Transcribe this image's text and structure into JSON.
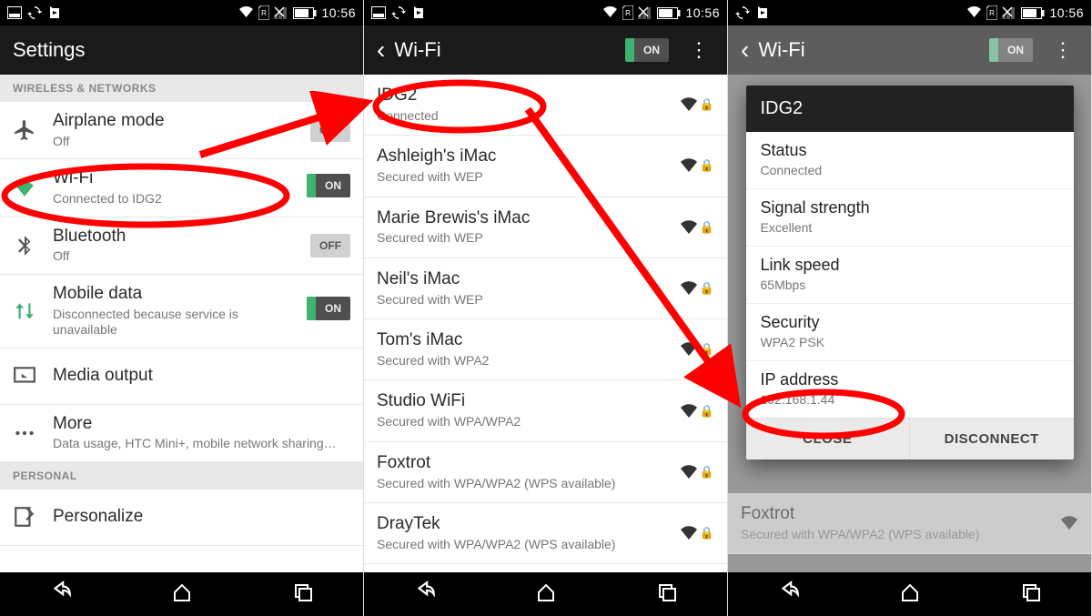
{
  "statusbar": {
    "time": "10:56"
  },
  "screen1": {
    "title": "Settings",
    "section1": "WIRELESS & NETWORKS",
    "section2": "PERSONAL",
    "rows": {
      "airplane": {
        "title": "Airplane mode",
        "sub": "Off",
        "toggle": "OFF"
      },
      "wifi": {
        "title": "Wi-Fi",
        "sub": "Connected to IDG2",
        "toggle": "ON"
      },
      "bluetooth": {
        "title": "Bluetooth",
        "sub": "Off",
        "toggle": "OFF"
      },
      "mobile": {
        "title": "Mobile data",
        "sub": "Disconnected because service is unavailable",
        "toggle": "ON"
      },
      "media": {
        "title": "Media output"
      },
      "more": {
        "title": "More",
        "sub": "Data usage, HTC Mini+, mobile network sharing…"
      },
      "personalize": {
        "title": "Personalize"
      }
    }
  },
  "screen2": {
    "title": "Wi-Fi",
    "toggle": "ON",
    "networks": [
      {
        "ssid": "IDG2",
        "sub": "Connected"
      },
      {
        "ssid": "Ashleigh's iMac",
        "sub": "Secured with WEP"
      },
      {
        "ssid": "Marie Brewis's iMac",
        "sub": "Secured with WEP"
      },
      {
        "ssid": "Neil's iMac",
        "sub": "Secured with WEP"
      },
      {
        "ssid": "Tom's iMac",
        "sub": "Secured with WPA2"
      },
      {
        "ssid": "Studio WiFi",
        "sub": "Secured with WPA/WPA2"
      },
      {
        "ssid": "Foxtrot",
        "sub": "Secured with WPA/WPA2 (WPS available)"
      },
      {
        "ssid": "DrayTek",
        "sub": "Secured with WPA/WPA2 (WPS available)"
      }
    ]
  },
  "screen3": {
    "title": "Wi-Fi",
    "toggle": "ON",
    "dialog": {
      "header": "IDG2",
      "rows": [
        {
          "label": "Status",
          "value": "Connected"
        },
        {
          "label": "Signal strength",
          "value": "Excellent"
        },
        {
          "label": "Link speed",
          "value": "65Mbps"
        },
        {
          "label": "Security",
          "value": "WPA2 PSK"
        },
        {
          "label": "IP address",
          "value": "192.168.1.44"
        }
      ],
      "close": "CLOSE",
      "disconnect": "DISCONNECT"
    },
    "behind_row": {
      "ssid": "Foxtrot",
      "sub": "Secured with WPA/WPA2 (WPS available)"
    }
  }
}
